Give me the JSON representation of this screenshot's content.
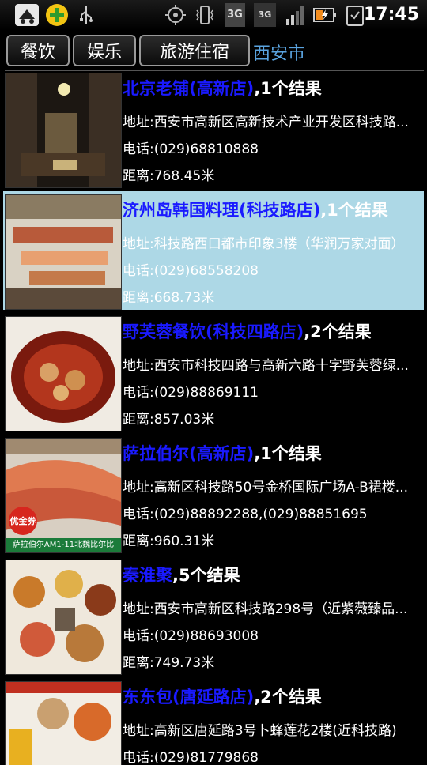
{
  "status_bar": {
    "time": "17:45",
    "signal_3g_label": "3G",
    "carrier_label": "3G IX",
    "icons": [
      "app-icon",
      "plus-icon",
      "usb-icon",
      "gps-icon",
      "vibrate-icon",
      "3g-icon",
      "signal-icon",
      "battery-charging-icon",
      "clipboard-icon"
    ]
  },
  "tabs": {
    "items": [
      "餐饮",
      "娱乐",
      "旅游住宿"
    ],
    "city": "西安市"
  },
  "results": [
    {
      "name": "北京老铺(高新店)",
      "count": ",1个结果",
      "address": "地址:西安市高新区高新技术产业开发区科技路...",
      "phone": "电话:(029)68810888",
      "distance": "距离:768.45米"
    },
    {
      "name": "济州岛韩国料理(科技路店)",
      "count": ",1个结果",
      "address": "地址:科技路西口都市印象3楼（华润万家对面）",
      "phone": "电话:(029)68558208",
      "distance": "距离:668.73米"
    },
    {
      "name": "野芙蓉餐饮(科技四路店)",
      "count": ",2个结果",
      "address": "地址:西安市科技四路与高新六路十字野芙蓉绿...",
      "phone": "电话:(029)88869111",
      "distance": "距离:857.03米"
    },
    {
      "name": "萨拉伯尔(高新店)",
      "count": ",1个结果",
      "address": "地址:高新区科技路50号金桥国际广场A-B裙楼...",
      "phone": "电话:(029)88892288,(029)88851695",
      "distance": "距离:960.31米",
      "badge": "优金券",
      "banner": "萨拉伯尔AM1-11北魏比尔比"
    },
    {
      "name": "秦淮聚",
      "count": ",5个结果",
      "address": "地址:西安市高新区科技路298号（近紫薇臻品...",
      "phone": "电话:(029)88693008",
      "distance": "距离:749.73米"
    },
    {
      "name": "东东包(唐延路店)",
      "count": ",2个结果",
      "address": "地址:高新区唐延路3号卜蜂莲花2楼(近科技路)",
      "phone": "电话:(029)81779868",
      "distance": ""
    }
  ],
  "colors": {
    "selected_row": "#add8e6",
    "name_link": "#1a1aff",
    "city": "#5aa3df"
  }
}
